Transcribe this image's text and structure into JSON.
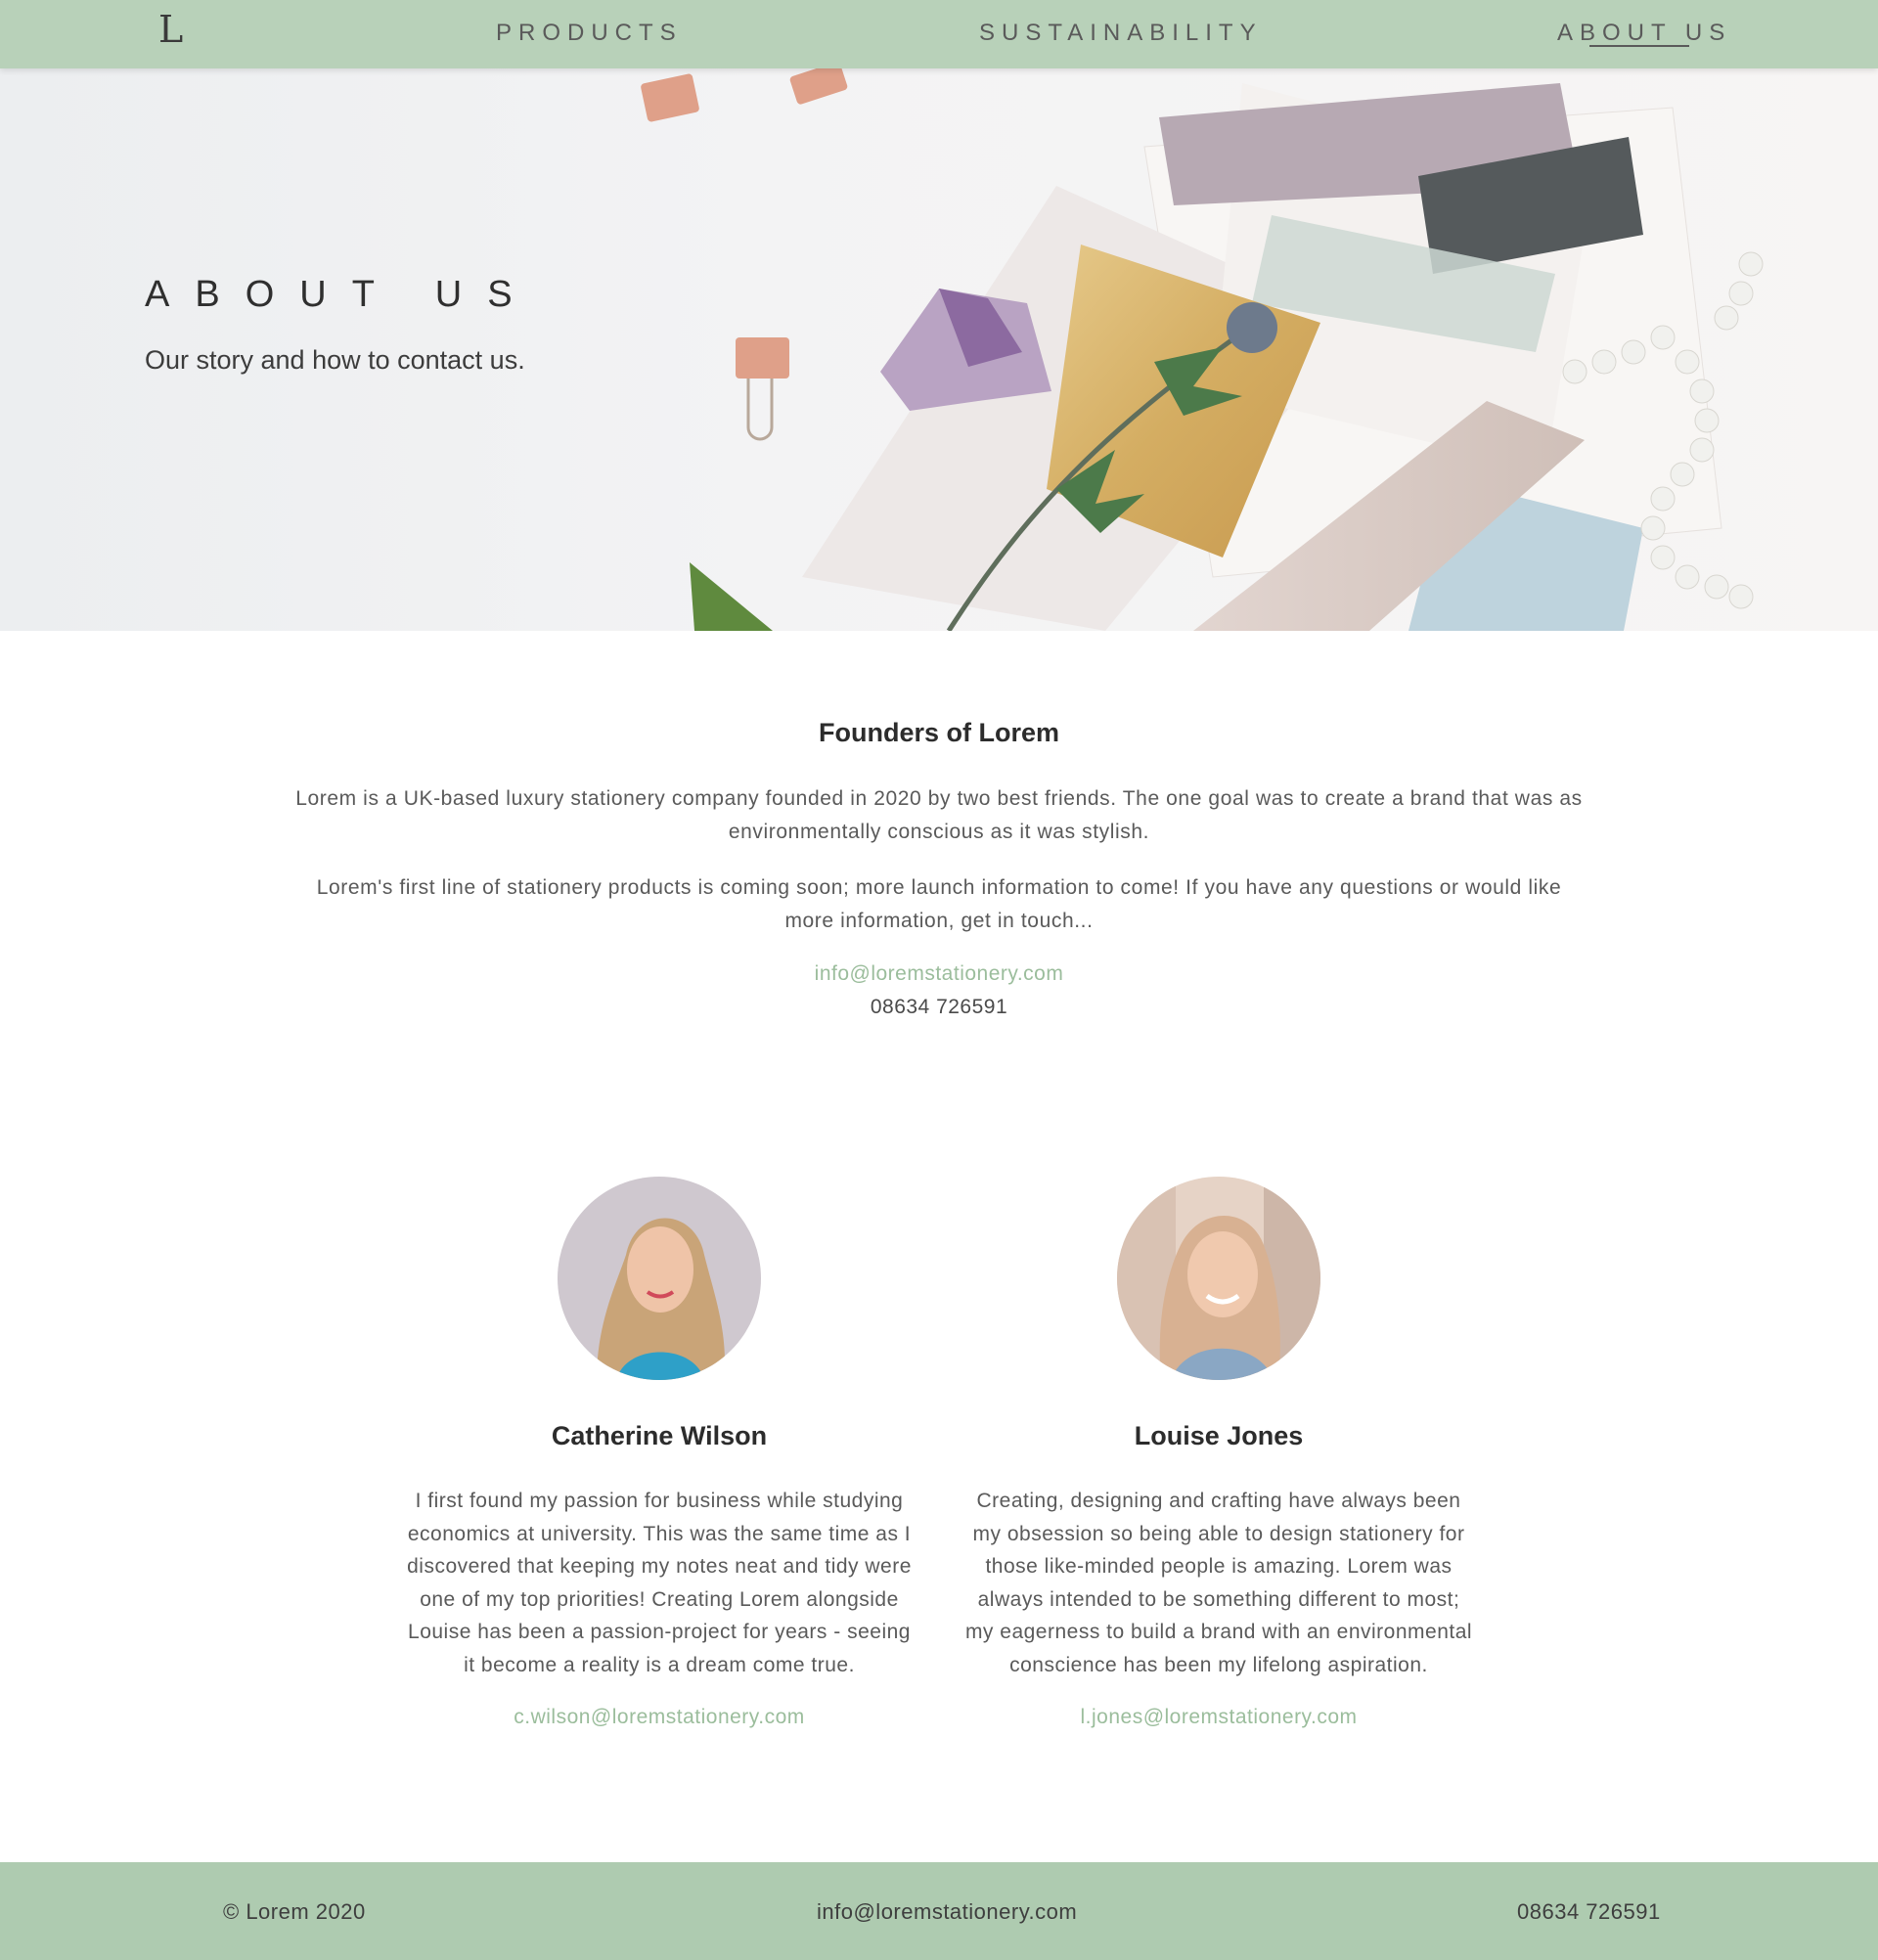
{
  "nav": {
    "logo": "L",
    "items": [
      {
        "label": "PRODUCTS"
      },
      {
        "label": "SUSTAINABILITY"
      },
      {
        "label": "ABOUT US",
        "active": true
      }
    ]
  },
  "hero": {
    "title": "ABOUT US",
    "subtitle": "Our story and how to contact us."
  },
  "founders": {
    "title": "Founders of Lorem",
    "paragraphs": [
      "Lorem is a UK-based luxury stationery company founded in 2020 by two best friends. The one goal was to create a brand that was as environmentally conscious as it was stylish.",
      "Lorem's first line of stationery products is coming soon; more launch information to come! If you have any questions or would like more information, get in touch..."
    ],
    "email": "info@loremstationery.com",
    "phone": "08634 726591"
  },
  "people": [
    {
      "name": "Catherine Wilson",
      "bio": "I first found my passion for business while studying economics at university. This was the same time as I discovered that keeping my notes neat and tidy were one of my top priorities! Creating Lorem alongside Louise has been a passion-project for years - seeing it become a reality is a dream come true.",
      "email": "c.wilson@loremstationery.com"
    },
    {
      "name": "Louise Jones",
      "bio": "Creating, designing and crafting have always been my obsession so being able to design stationery for those like-minded people is amazing. Lorem was always intended to be something different to most; my eagerness to build a brand with an environmental conscience has been my lifelong aspiration.",
      "email": "l.jones@loremstationery.com"
    }
  ],
  "footer": {
    "copyright": "© Lorem 2020",
    "email": "info@loremstationery.com",
    "phone": "08634 726591"
  },
  "colors": {
    "nav_bg": "#b8d1b9",
    "footer_bg": "#aecbb0",
    "accent_link": "#9bbd9c"
  }
}
